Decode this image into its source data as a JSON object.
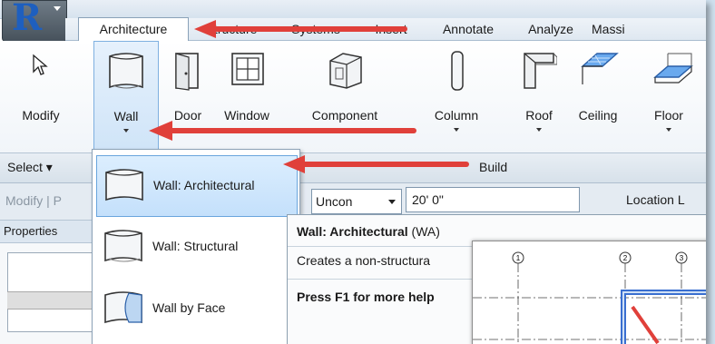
{
  "tabs": [
    {
      "label": "Architecture",
      "active": true
    },
    {
      "label": "Structure",
      "active": false
    },
    {
      "label": "Systems",
      "active": false
    },
    {
      "label": "Insert",
      "active": false
    },
    {
      "label": "Annotate",
      "active": false
    },
    {
      "label": "Analyze",
      "active": false
    },
    {
      "label": "Massi",
      "active": false
    }
  ],
  "ribbon": {
    "tools": [
      {
        "label": "Modify",
        "icon": "cursor-icon"
      },
      {
        "label": "Wall",
        "icon": "wall-icon"
      },
      {
        "label": "Door",
        "icon": "door-icon"
      },
      {
        "label": "Window",
        "icon": "window-icon"
      },
      {
        "label": "Component",
        "icon": "component-icon"
      },
      {
        "label": "Column",
        "icon": "column-icon"
      },
      {
        "label": "Roof",
        "icon": "roof-icon"
      },
      {
        "label": "Ceiling",
        "icon": "ceiling-icon"
      },
      {
        "label": "Floor",
        "icon": "floor-icon"
      }
    ],
    "select_label": "Select ▾",
    "build_label": "Build"
  },
  "options_bar": {
    "modify_label": "Modify | P",
    "constraint_value": "Uncon",
    "height_value": "20'  0\"",
    "location_label": "Location L"
  },
  "properties_label": "Properties",
  "wall_menu": {
    "items": [
      {
        "label": "Wall: Architectural",
        "selected": true
      },
      {
        "label": "Wall: Structural",
        "selected": false
      },
      {
        "label": "Wall by Face",
        "selected": false
      }
    ]
  },
  "tooltip": {
    "title": "Wall: Architectural",
    "shortcut": "(WA)",
    "description": "Creates a non-structura",
    "help": "Press F1 for more help"
  },
  "inset": {
    "grid_labels": [
      "1",
      "2",
      "3"
    ]
  },
  "colors": {
    "accent_red": "#e0403a",
    "wall_blue": "#3a6fd0",
    "ribbon_bg": "#f1f5f9",
    "selection_bg": "#c4e0fb"
  }
}
